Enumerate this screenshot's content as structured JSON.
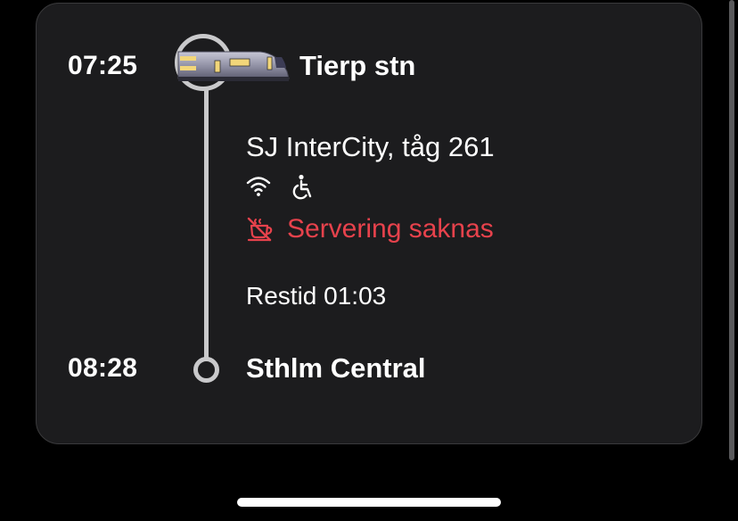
{
  "departure": {
    "time": "07:25",
    "station": "Tierp stn"
  },
  "arrival": {
    "time": "08:28",
    "station": "Sthlm Central"
  },
  "train": {
    "name": "SJ InterCity, tåg 261",
    "icon": "train-icon",
    "amenities": [
      "wifi-icon",
      "wheelchair-accessible-icon"
    ]
  },
  "service": {
    "text": "Servering saknas",
    "icon": "no-food-service-icon",
    "color": "#e7424c"
  },
  "travel_time": "Restid 01:03",
  "colors": {
    "background": "#000000",
    "card": "#1c1c1e",
    "timeline": "#c9c9cb",
    "warning": "#e7424c"
  }
}
